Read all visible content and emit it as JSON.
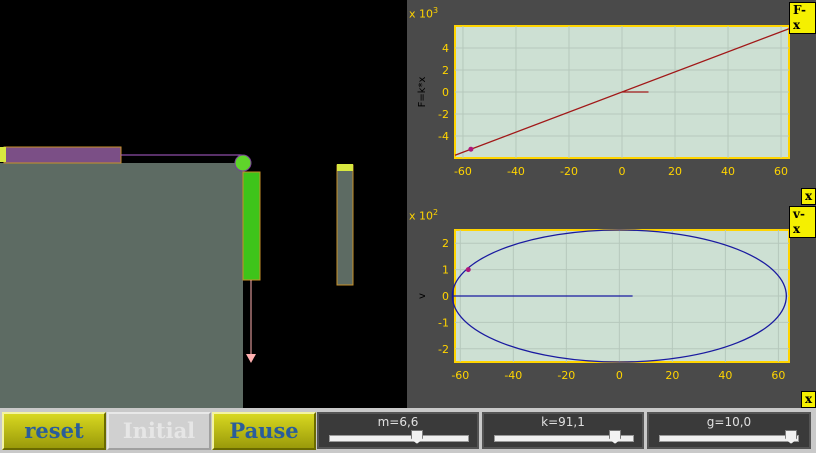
{
  "colors": {
    "sim_bg": "#000000",
    "table": "#5d6b63",
    "spring_block": "#7b4f86",
    "hanging_mass": "#3ec41a",
    "pulley": "#5fd52a",
    "panel_bg": "#4a4a4a",
    "plot_bg": "#cde0d3",
    "axis_text": "#ffd400",
    "fx_curve": "#a11818",
    "vx_curve": "#1a1aa0",
    "marker": "#b0177a",
    "toolbar_bg": "#c9c9c9",
    "button_text": "#2a5d9a"
  },
  "simulation": {
    "scene": "spring-mass on table with pulley and hanging mass"
  },
  "graphs": {
    "fx": {
      "tag": "F-x",
      "x_tag": "x",
      "exponent_base": "x 10",
      "exponent_power": "3",
      "ylabel": "F=k*x"
    },
    "vx": {
      "tag": "v-x",
      "x_tag": "x",
      "exponent_base": "x 10",
      "exponent_power": "2",
      "ylabel": "v"
    }
  },
  "chart_data": [
    {
      "type": "line",
      "ylabel": "F=k*x",
      "x_ticks": [
        -60,
        -40,
        -20,
        0,
        20,
        40,
        60
      ],
      "y_ticks": [
        -4,
        -2,
        0,
        2,
        4
      ],
      "xlim": [
        -63,
        63
      ],
      "ylim": [
        -6.0,
        6.0
      ],
      "grid": true,
      "series": [
        {
          "x": [
            -63,
            63
          ],
          "y": [
            -5.75,
            5.75
          ]
        },
        {
          "x": [
            0,
            10
          ],
          "y": [
            0,
            0
          ]
        }
      ],
      "current_point": {
        "x": -57,
        "y": -5.2
      }
    },
    {
      "type": "line",
      "ylabel": "v",
      "x_ticks": [
        -60,
        -40,
        -20,
        0,
        20,
        40,
        60
      ],
      "y_ticks": [
        -2,
        -1,
        0,
        1,
        2
      ],
      "xlim": [
        -62,
        64
      ],
      "ylim": [
        -2.5,
        2.5
      ],
      "grid": true,
      "series": [
        {
          "shape": "ellipse",
          "center_x": 0,
          "center_y": 0,
          "x_amplitude": 63,
          "y_amplitude": 2.5
        },
        {
          "x": [
            -63,
            5
          ],
          "y": [
            0,
            0
          ]
        }
      ],
      "current_point": {
        "x": -57,
        "y": 1.0
      }
    }
  ],
  "toolbar": {
    "reset_label": "reset",
    "initial_label": "Initial",
    "pause_label": "Pause"
  },
  "sliders": [
    {
      "label": "m=6,6",
      "fraction": 0.63
    },
    {
      "label": "k=91,1",
      "fraction": 0.87
    },
    {
      "label": "g=10,0",
      "fraction": 0.95
    }
  ]
}
